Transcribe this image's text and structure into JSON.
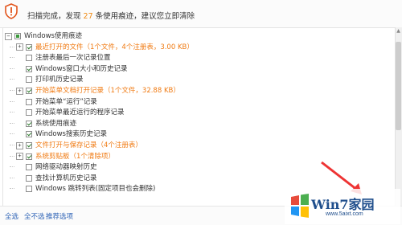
{
  "header": {
    "prefix": "扫描完成，发现",
    "count": "27",
    "suffix": "条使用痕迹，建议您立即清除"
  },
  "tree": [
    {
      "label": "Windows使用痕迹",
      "state": "partial",
      "level": 0,
      "expander": "−",
      "color": "normal"
    },
    {
      "label": "最近打开的文件（1个文件，4个注册表，3.00 KB）",
      "state": "checked",
      "level": 1,
      "expander": "+",
      "color": "orange"
    },
    {
      "label": "注册表最后一次记录位置",
      "state": "unchecked",
      "level": 1,
      "expander": "",
      "color": "normal"
    },
    {
      "label": "Windows窗口大小和历史记录",
      "state": "checked",
      "level": 1,
      "expander": "",
      "color": "normal"
    },
    {
      "label": "打印机历史记录",
      "state": "unchecked",
      "level": 1,
      "expander": "",
      "color": "normal"
    },
    {
      "label": "开始菜单文档打开记录（1个文件，32.88 KB）",
      "state": "checked",
      "level": 1,
      "expander": "+",
      "color": "orange"
    },
    {
      "label": "开始菜单“运行”记录",
      "state": "unchecked",
      "level": 1,
      "expander": "",
      "color": "normal"
    },
    {
      "label": "开始菜单最近运行的程序记录",
      "state": "unchecked",
      "level": 1,
      "expander": "",
      "color": "normal"
    },
    {
      "label": "系统使用痕迹",
      "state": "checked",
      "level": 1,
      "expander": "",
      "color": "normal"
    },
    {
      "label": "Windows搜索历史记录",
      "state": "checked",
      "level": 1,
      "expander": "",
      "color": "normal"
    },
    {
      "label": "文件打开与保存记录（4个注册表）",
      "state": "checked",
      "level": 1,
      "expander": "+",
      "color": "orange"
    },
    {
      "label": "系统剪贴板（1个清除项）",
      "state": "checked",
      "level": 1,
      "expander": "+",
      "color": "orange"
    },
    {
      "label": "网络驱动器映射历史",
      "state": "unchecked",
      "level": 1,
      "expander": "",
      "color": "normal"
    },
    {
      "label": "查找计算机历史记录",
      "state": "unchecked",
      "level": 1,
      "expander": "",
      "color": "normal"
    },
    {
      "label": "Windows 跳转列表(固定项目也会删除)",
      "state": "unchecked",
      "level": 1,
      "expander": "",
      "color": "normal"
    }
  ],
  "footer": {
    "select_all": "全选",
    "select_none": "全不选",
    "recommended": "推荐选项"
  },
  "watermark": {
    "brand": "Win7家园",
    "url": "www.5aixt.com",
    "icon": "windows-logo-icon"
  },
  "colors": {
    "accent": "#f07a12",
    "link": "#2e63b6",
    "check": "#2a7a2a",
    "warning_icon": "#e2541b"
  }
}
